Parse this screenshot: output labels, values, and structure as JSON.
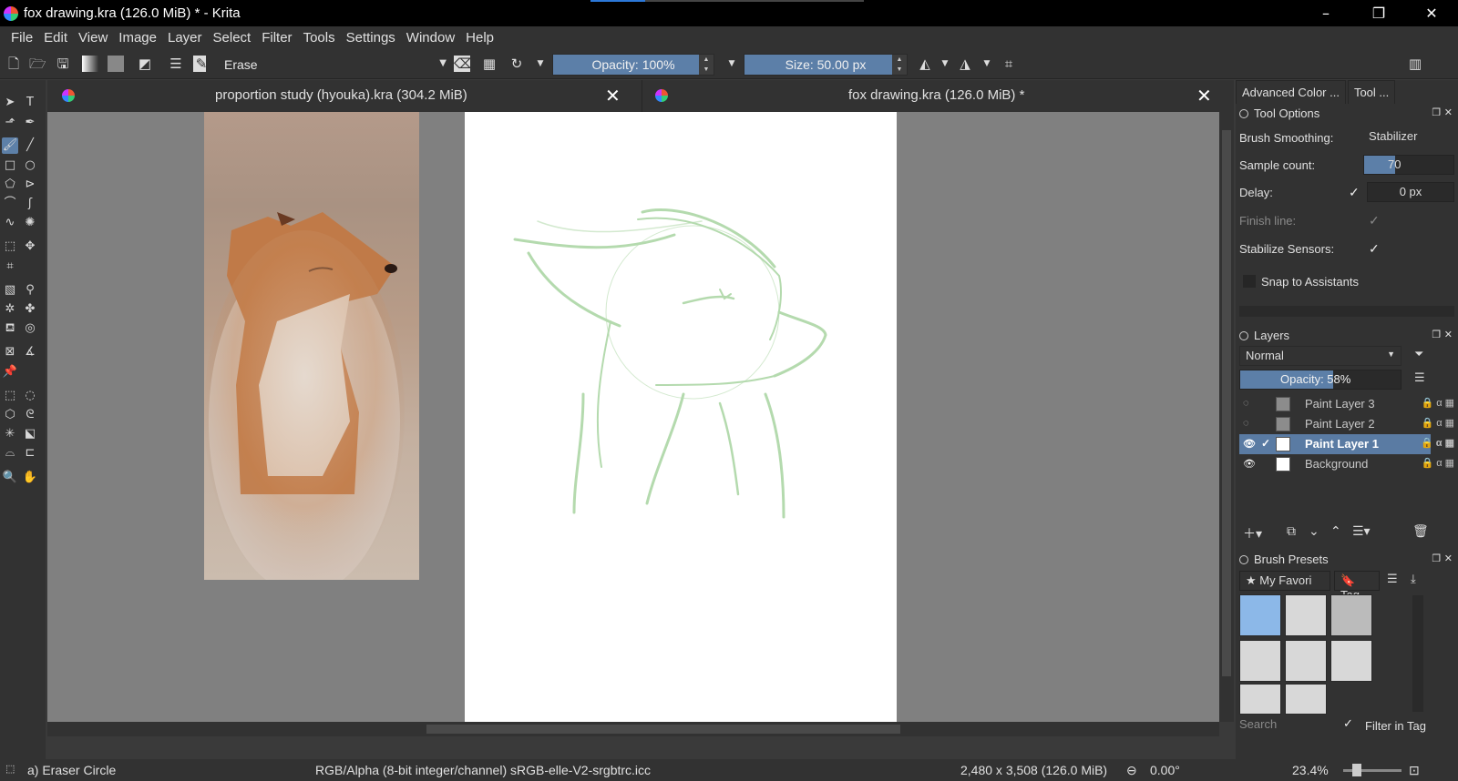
{
  "window": {
    "title": "fox drawing.kra (126.0 MiB) * - Krita",
    "controls": [
      "–",
      "❐",
      "✕"
    ]
  },
  "menu": [
    "File",
    "Edit",
    "View",
    "Image",
    "Layer",
    "Select",
    "Filter",
    "Tools",
    "Settings",
    "Window",
    "Help"
  ],
  "toolbar": {
    "brush_preset": "Erase",
    "opacity": "Opacity: 100%",
    "size": "Size: 50.00 px"
  },
  "tabs": [
    {
      "name": "proportion study (hyouka).kra (304.2 MiB)",
      "close": "✕"
    },
    {
      "name": "fox drawing.kra (126.0 MiB) *",
      "close": "✕"
    }
  ],
  "dock": {
    "tabs": [
      "Advanced Color ...",
      "Tool ..."
    ],
    "tool_options": {
      "title": "Tool Options",
      "brush_smoothing_label": "Brush Smoothing:",
      "brush_smoothing_value": "Stabilizer",
      "sample_count_label": "Sample count:",
      "sample_count_value": "70",
      "sample_count_fill": 0.35,
      "delay_label": "Delay:",
      "delay_value": "0 px",
      "finish_line_label": "Finish line:",
      "stabilize_sensors_label": "Stabilize Sensors:",
      "snap_label": "Snap to Assistants"
    },
    "layers": {
      "title": "Layers",
      "blend_mode": "Normal",
      "opacity": "Opacity: 58%",
      "opacity_fill": 0.58,
      "items": [
        {
          "name": "Paint Layer 3",
          "visible": false,
          "selected": false
        },
        {
          "name": "Paint Layer 2",
          "visible": false,
          "selected": false
        },
        {
          "name": "Paint Layer 1",
          "visible": true,
          "selected": true
        },
        {
          "name": "Background",
          "visible": true,
          "selected": false
        }
      ]
    },
    "brush_presets": {
      "title": "Brush Presets",
      "tag_filter": "My Favori",
      "tag_button": "Tag",
      "search_placeholder": "Search",
      "filter_in_tag": "Filter in Tag"
    }
  },
  "status": {
    "tool": "a) Eraser Circle",
    "color_space": "RGB/Alpha (8-bit integer/channel)  sRGB-elle-V2-srgbtrc.icc",
    "dimensions": "2,480 x 3,508 (126.0 MiB)",
    "rotation": "0.00°",
    "zoom": "23.4%"
  },
  "colors": {
    "accent": "#5d80a8",
    "panel": "#323232",
    "canvas_bg": "#808080",
    "sketch": "#a8d4a0"
  }
}
